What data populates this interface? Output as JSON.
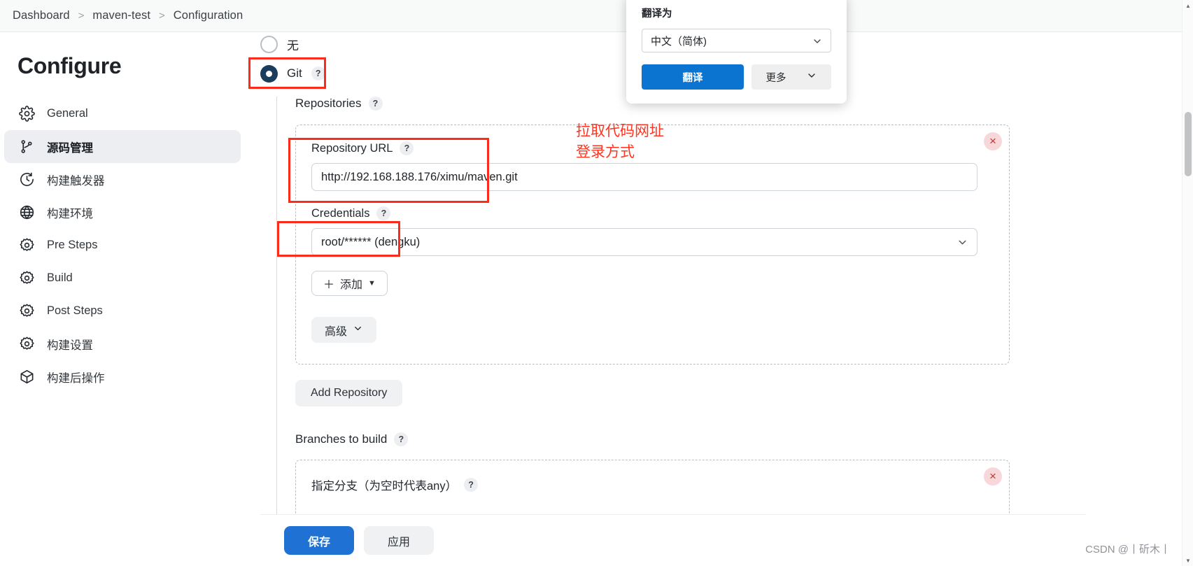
{
  "breadcrumb": {
    "items": [
      "Dashboard",
      "maven-test",
      "Configuration"
    ],
    "separator": ">"
  },
  "sidebar": {
    "title": "Configure",
    "items": [
      {
        "label": "General",
        "icon": "gear-icon",
        "active": false
      },
      {
        "label": "源码管理",
        "icon": "source-branch-icon",
        "active": true
      },
      {
        "label": "构建触发器",
        "icon": "clock-icon",
        "active": false
      },
      {
        "label": "构建环境",
        "icon": "globe-icon",
        "active": false
      },
      {
        "label": "Pre Steps",
        "icon": "gear-icon",
        "active": false
      },
      {
        "label": "Build",
        "icon": "gear-icon",
        "active": false
      },
      {
        "label": "Post Steps",
        "icon": "gear-icon",
        "active": false
      },
      {
        "label": "构建设置",
        "icon": "gear-icon",
        "active": false
      },
      {
        "label": "构建后操作",
        "icon": "package-icon",
        "active": false
      }
    ]
  },
  "scm": {
    "options": [
      {
        "label": "无",
        "selected": false,
        "help": false
      },
      {
        "label": "Git",
        "selected": true,
        "help": true
      }
    ],
    "repositories_label": "Repositories",
    "repository": {
      "url_label": "Repository URL",
      "url_value": "http://192.168.188.176/ximu/maven.git",
      "credentials_label": "Credentials",
      "credentials_value": "root/****** (dengku)",
      "add_button": "添加",
      "add_button_prefix": "＋",
      "advanced_button": "高级",
      "remove_icon": "close-icon"
    },
    "add_repository_button": "Add Repository",
    "branches_label": "Branches to build",
    "branch_spec_label": "指定分支（为空时代表any）",
    "branch_remove_icon": "close-icon",
    "help_glyph": "?"
  },
  "footer": {
    "save_button": "保存",
    "apply_button": "应用"
  },
  "translate_popup": {
    "title": "翻译为",
    "language_value": "中文（简体)",
    "translate_button": "翻译",
    "more_button": "更多",
    "chevron": "chevron-down-icon"
  },
  "annotations": {
    "note_lines": "拉取代码网址\n登录方式"
  },
  "watermark": "CSDN @丨斫木丨",
  "colors": {
    "accent_blue": "#1f72d4",
    "popup_blue": "#0b74d1",
    "annotation_red": "#fe3520",
    "radio_selected": "#1b3d5c",
    "sidebar_active_bg": "#eceef1"
  }
}
